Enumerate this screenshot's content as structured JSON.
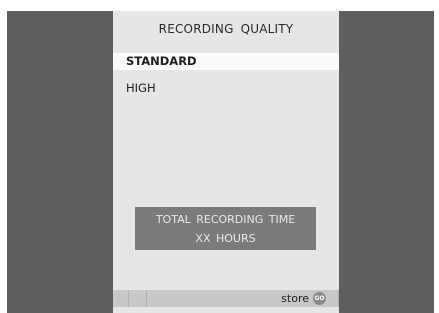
{
  "menu": {
    "title": "RECORDING QUALITY",
    "items": [
      {
        "label": "STANDARD",
        "selected": true
      },
      {
        "label": "HIGH",
        "selected": false
      }
    ]
  },
  "info": {
    "line1": "TOTAL RECORDING TIME",
    "line2": "XX HOURS"
  },
  "status_bar": {
    "store_label": "store",
    "go_icon_text": "GO",
    "go_icon": "go-button-icon"
  },
  "colors": {
    "backdrop": "#5e5e5e",
    "panel": "#e6e6e6",
    "selected_row": "#fafafa",
    "info_box": "#7b7b7b",
    "status_bar": "#c8c8c8"
  }
}
